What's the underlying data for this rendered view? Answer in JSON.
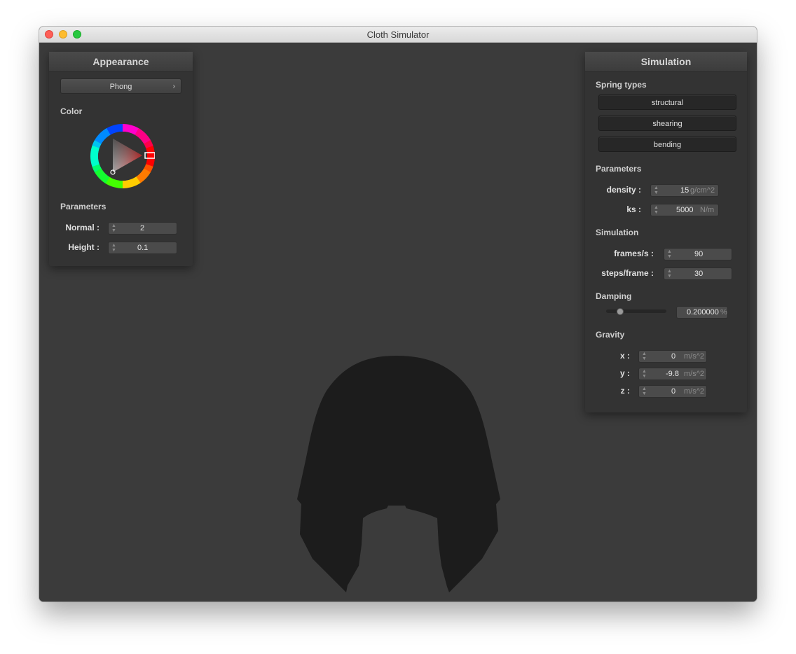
{
  "window": {
    "title": "Cloth Simulator"
  },
  "appearance": {
    "header": "Appearance",
    "shader": "Phong",
    "color_label": "Color",
    "color_value": "#e53030",
    "params_label": "Parameters",
    "normal": {
      "label": "Normal :",
      "value": "2"
    },
    "height": {
      "label": "Height :",
      "value": "0.1"
    }
  },
  "simulation": {
    "header": "Simulation",
    "spring_label": "Spring types",
    "springs": [
      "structural",
      "shearing",
      "bending"
    ],
    "params_label": "Parameters",
    "density": {
      "label": "density :",
      "value": "15",
      "unit": "g/cm^2"
    },
    "ks": {
      "label": "ks :",
      "value": "5000",
      "unit": "N/m"
    },
    "sim_label": "Simulation",
    "fps": {
      "label": "frames/s :",
      "value": "90"
    },
    "steps": {
      "label": "steps/frame :",
      "value": "30"
    },
    "damping_label": "Damping",
    "damping": {
      "value": "0.200000",
      "unit": "%",
      "slider_fraction": 0.2
    },
    "gravity_label": "Gravity",
    "gx": {
      "label": "x :",
      "value": "0",
      "unit": "m/s^2"
    },
    "gy": {
      "label": "y :",
      "value": "-9.8",
      "unit": "m/s^2"
    },
    "gz": {
      "label": "z :",
      "value": "0",
      "unit": "m/s^2"
    }
  }
}
